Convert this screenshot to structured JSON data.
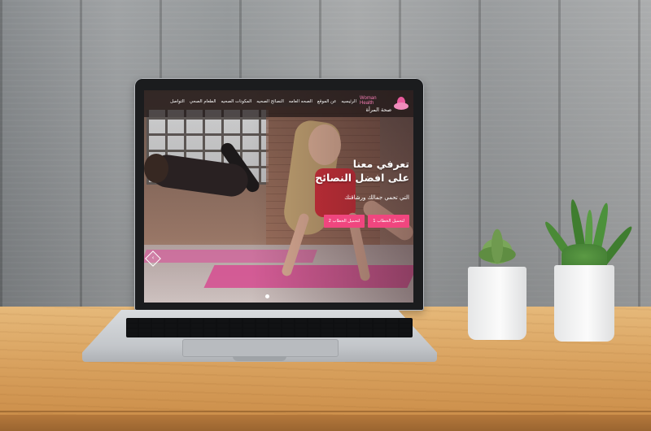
{
  "website": {
    "logo": {
      "english": "Woman Health",
      "arabic": "صحة المرأة"
    },
    "nav": {
      "items": [
        "الرئيسيه",
        "عن الموقع",
        "الصحه العامه",
        "النصائح الصحيه",
        "المكونات الصحيه",
        "الطعام الصحي",
        "التواصل"
      ]
    },
    "hero": {
      "title_line1": "تعرفي معنا",
      "title_line2": "على افضل النصائح",
      "subtitle": "التي تحمي جمالك ورشاقتك",
      "button1": "لتحميل الخطاب 1",
      "button2": "لتحميل الخطاب 2",
      "arrow_icon": "‹",
      "accent_color": "#f0467f"
    }
  },
  "scene": {
    "description_colors": {
      "wall": "#a9acae",
      "desk": "#d9a25f",
      "laptop_bezel": "#1b1c1e"
    }
  }
}
